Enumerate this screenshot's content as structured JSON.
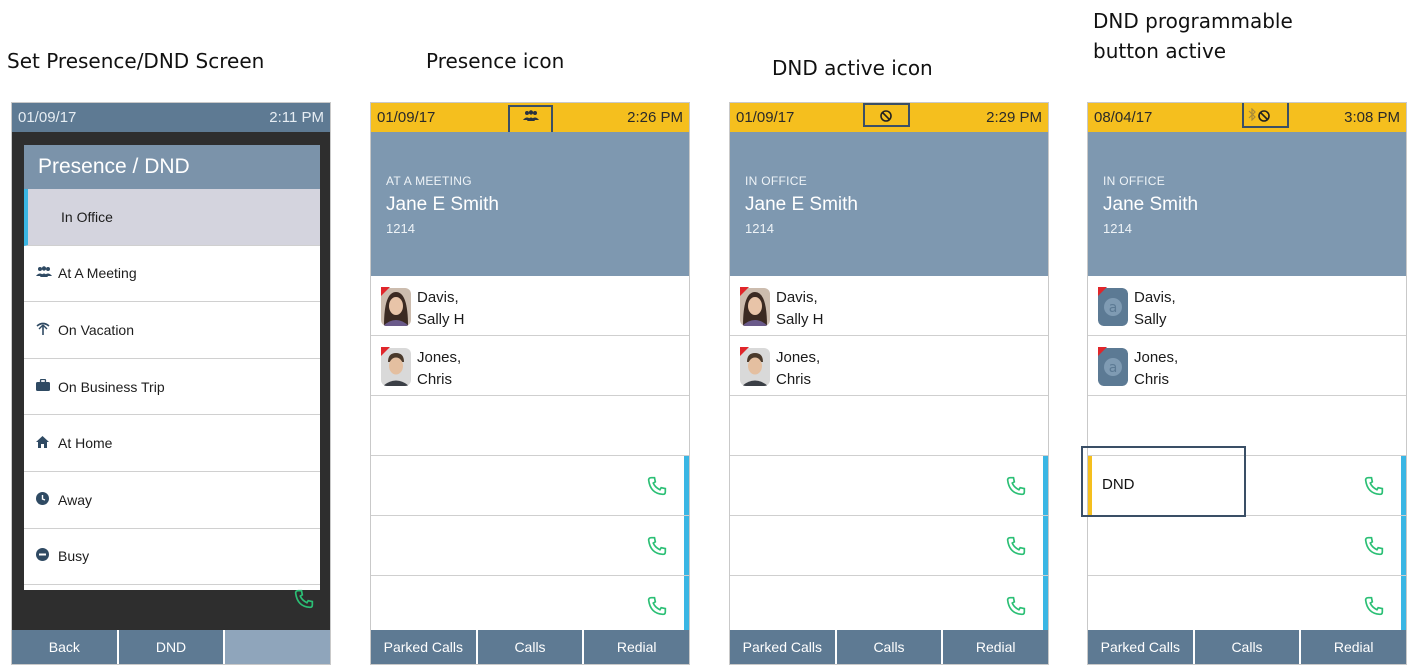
{
  "captions": {
    "panel1": "Set Presence/DND Screen",
    "panel2": "Presence icon",
    "panel3": "DND active icon",
    "panel4_line1": "DND programmable",
    "panel4_line2": "button active"
  },
  "panel1": {
    "date": "01/09/17",
    "time": "2:11 PM",
    "dialog_title": "Presence / DND",
    "items": [
      {
        "label": "In Office",
        "icon": "none",
        "selected": true
      },
      {
        "label": "At A Meeting",
        "icon": "people-icon"
      },
      {
        "label": "On Vacation",
        "icon": "palm-tree-icon"
      },
      {
        "label": "On Business Trip",
        "icon": "briefcase-icon"
      },
      {
        "label": "At Home",
        "icon": "home-icon"
      },
      {
        "label": "Away",
        "icon": "clock-icon"
      },
      {
        "label": "Busy",
        "icon": "minus-circle-icon"
      }
    ],
    "softkeys": [
      "Back",
      "DND",
      ""
    ]
  },
  "panel2": {
    "date": "01/09/17",
    "time": "2:26 PM",
    "status_icon": "people-icon",
    "presence": "AT A MEETING",
    "name": "Jane E Smith",
    "extension": "1214",
    "contacts": [
      {
        "last": "Davis,",
        "first": "Sally H",
        "avatar": "photo-woman"
      },
      {
        "last": "Jones,",
        "first": "Chris",
        "avatar": "photo-man"
      }
    ],
    "softkeys": [
      "Parked Calls",
      "Calls",
      "Redial"
    ]
  },
  "panel3": {
    "date": "01/09/17",
    "time": "2:29 PM",
    "status_icon": "dnd-icon",
    "presence": "IN OFFICE",
    "name": "Jane E Smith",
    "extension": "1214",
    "contacts": [
      {
        "last": "Davis,",
        "first": "Sally H",
        "avatar": "photo-woman"
      },
      {
        "last": "Jones,",
        "first": "Chris",
        "avatar": "photo-man"
      }
    ],
    "softkeys": [
      "Parked Calls",
      "Calls",
      "Redial"
    ]
  },
  "panel4": {
    "date": "08/04/17",
    "time": "3:08 PM",
    "status_icon": "dnd-icon",
    "presence": "IN OFFICE",
    "name": "Jane Smith",
    "extension": "1214",
    "contacts": [
      {
        "last": "Davis,",
        "first": "Sally",
        "avatar": "placeholder-a"
      },
      {
        "last": "Jones,",
        "first": "Chris",
        "avatar": "placeholder-a"
      }
    ],
    "dnd_button": "DND",
    "softkeys": [
      "Parked Calls",
      "Calls",
      "Redial"
    ]
  },
  "colors": {
    "status_yellow": "#f5bf1e",
    "header_blue": "#7e98b0",
    "softkey_blue": "#5e7a93",
    "line_accent": "#3ab6e4",
    "call_green": "#2bbf75"
  }
}
